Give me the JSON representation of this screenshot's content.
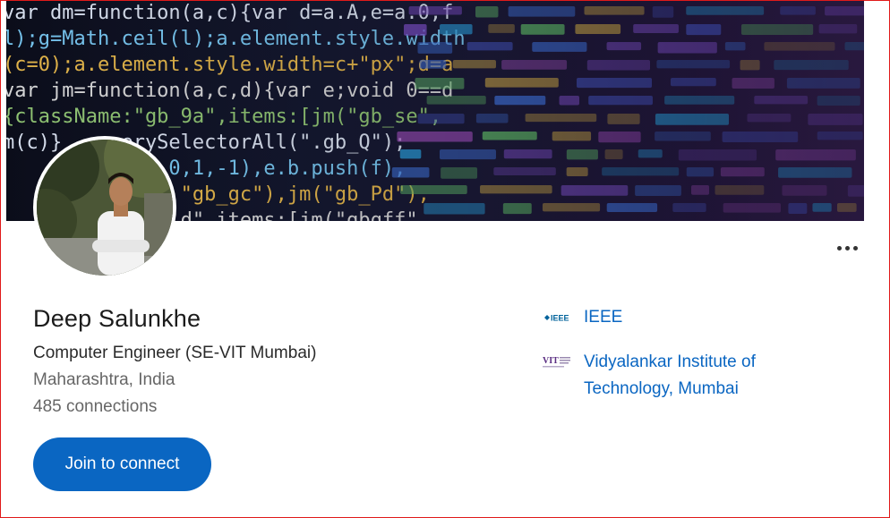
{
  "profile": {
    "name": "Deep Salunkhe",
    "headline": "Computer Engineer (SE-VIT Mumbai)",
    "location": "Maharashtra, India",
    "connections": "485 connections"
  },
  "actions": {
    "join_label": "Join to connect",
    "more_icon": "more-horizontal-icon"
  },
  "organizations": [
    {
      "name": "IEEE",
      "logo_icon": "ieee-logo-icon"
    },
    {
      "name": "Vidyalankar Institute of Technology, Mumbai",
      "logo_icon": "vit-logo-icon"
    }
  ],
  "cover": {
    "code_lines": [
      "var dm=function(a,c){var d=a.A,e=a.0,f",
      "l);g=Math.ceil(l);a.element.style.width",
      "(c=0);a.element.style.width=c+\"px\";d=a",
      "var jm=function(a,c,d){var e;void 0==d",
      "{className:\"gb_9a\",items:[jm(\"gb_se\",",
      "m(c)}     erySelectorAll(\".gb_Q\");",
      "              0,1,-1),e.b.push(f),",
      "               \"gb_gc\"),jm(\"gb_Pd\"),",
      "               d\" items:[jm(\"gbqff\""
    ]
  },
  "colors": {
    "accent": "#0a66c2",
    "border": "#e01a1a"
  }
}
